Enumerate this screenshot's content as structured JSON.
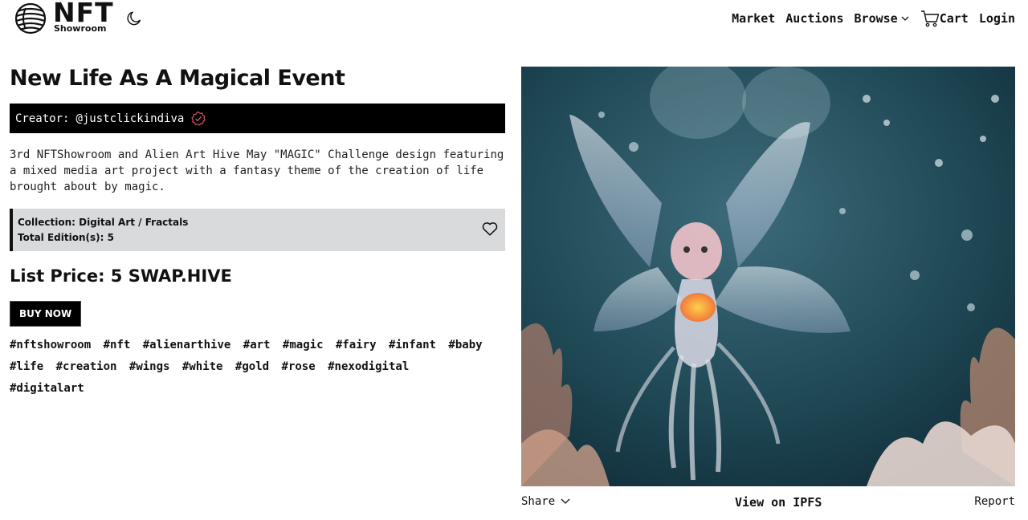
{
  "header": {
    "logo_title": "NFT",
    "logo_subtitle": "Showroom",
    "nav": {
      "market": "Market",
      "auctions": "Auctions",
      "browse": "Browse",
      "cart": "Cart",
      "login": "Login"
    }
  },
  "item": {
    "title": "New Life As A Magical Event",
    "creator_label": "Creator:",
    "creator_handle": "@justclickindiva",
    "description": "3rd NFTShowroom and Alien Art Hive May \"MAGIC\" Challenge design featuring a mixed media art project with a fantasy theme of the creation of life brought about by magic.",
    "collection": "Collection: Digital Art / Fractals",
    "editions": "Total Edition(s): 5",
    "price": "List Price: 5 SWAP.HIVE",
    "buy_label": "BUY NOW",
    "tags": [
      "#nftshowroom",
      "#nft",
      "#alienarthive",
      "#art",
      "#magic",
      "#fairy",
      "#infant",
      "#baby",
      "#life",
      "#creation",
      "#wings",
      "#white",
      "#gold",
      "#rose",
      "#nexodigital",
      "#digitalart"
    ]
  },
  "footer": {
    "share": "Share",
    "ipfs": "View on IPFS",
    "report": "Report"
  },
  "colors": {
    "background": "#ffffff",
    "text": "#111111",
    "creator_bar": "#000000",
    "collection_bg": "#d9dadc",
    "verified_accent": "#e0576a"
  }
}
